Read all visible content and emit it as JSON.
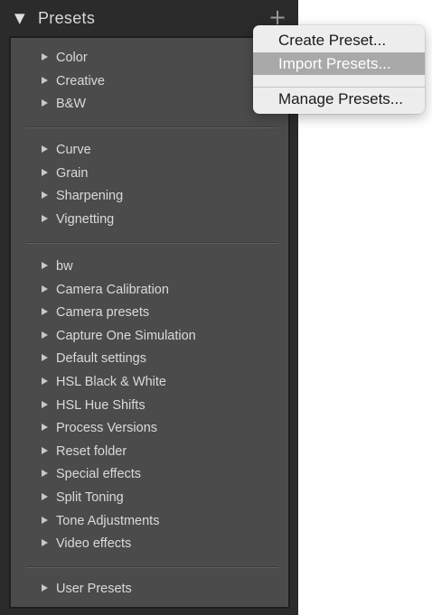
{
  "panel": {
    "title": "Presets",
    "collapse_glyph": "▼",
    "add_glyph": "+"
  },
  "groups": [
    {
      "items": [
        {
          "label": "Color"
        },
        {
          "label": "Creative"
        },
        {
          "label": "B&W"
        }
      ]
    },
    {
      "items": [
        {
          "label": "Curve"
        },
        {
          "label": "Grain"
        },
        {
          "label": "Sharpening"
        },
        {
          "label": "Vignetting"
        }
      ]
    },
    {
      "items": [
        {
          "label": "bw"
        },
        {
          "label": "Camera Calibration"
        },
        {
          "label": "Camera presets"
        },
        {
          "label": "Capture One Simulation"
        },
        {
          "label": "Default settings"
        },
        {
          "label": "HSL Black & White"
        },
        {
          "label": "HSL Hue Shifts"
        },
        {
          "label": "Process Versions"
        },
        {
          "label": "Reset folder"
        },
        {
          "label": "Special effects"
        },
        {
          "label": "Split Toning"
        },
        {
          "label": "Tone Adjustments"
        },
        {
          "label": "Video effects"
        }
      ]
    },
    {
      "items": [
        {
          "label": "User Presets"
        }
      ]
    }
  ],
  "context_menu": {
    "items": [
      {
        "label": "Create Preset...",
        "highlighted": false
      },
      {
        "label": "Import Presets...",
        "highlighted": true
      },
      {
        "label": "Manage Presets...",
        "highlighted": false
      }
    ]
  },
  "colors": {
    "panel_bg": "#2b2b2b",
    "list_bg": "#4b4b4b",
    "menu_bg": "#ededed",
    "menu_highlight": "#a9a9a9"
  }
}
